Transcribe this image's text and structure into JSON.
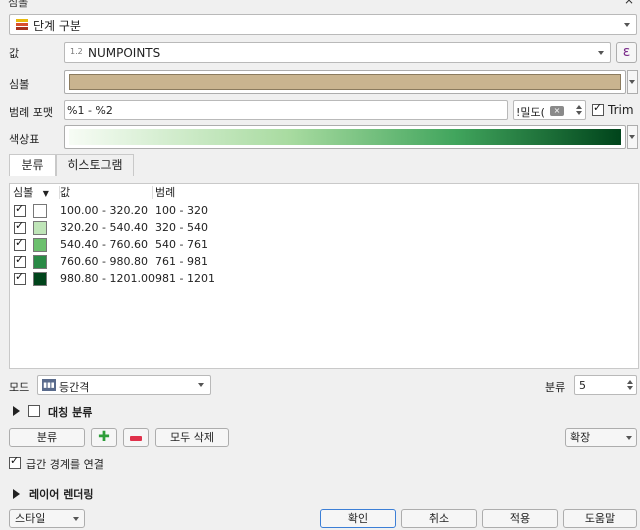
{
  "window": {
    "title": "심볼",
    "close_glyph": "×"
  },
  "renderer": {
    "selected": "단계 구분",
    "icon": "graduated-renderer-icon",
    "icon_colors": [
      "#e8b90d",
      "#d94f2b",
      "#a8321b"
    ]
  },
  "value_row": {
    "label": "값",
    "type_prefix": "1.2",
    "field": "NUMPOINTS",
    "expression_glyph": "ε"
  },
  "symbol_row": {
    "label": "심볼",
    "color": "#c9b48f"
  },
  "legend_format": {
    "label": "범례 포맷",
    "value": "%1 - %2",
    "precision_value": "!밀도(",
    "trim_label": "Trim",
    "trim_checked": true
  },
  "color_ramp": {
    "label": "색상표",
    "from": "#f7fcf5",
    "to": "#00441b"
  },
  "tabs": [
    {
      "label": "분류",
      "active": true
    },
    {
      "label": "히스토그램",
      "active": false
    }
  ],
  "table": {
    "headers": {
      "symbol": "심볼",
      "value": "값",
      "legend": "범례"
    },
    "rows": [
      {
        "checked": true,
        "color": "#ffffff",
        "value": "100.00 - 320.20",
        "legend": "100 - 320"
      },
      {
        "checked": true,
        "color": "#bfe5b8",
        "value": "320.20 - 540.40",
        "legend": "320 - 540"
      },
      {
        "checked": true,
        "color": "#6cc06e",
        "value": "540.40 - 760.60",
        "legend": "540 - 761"
      },
      {
        "checked": true,
        "color": "#2a8a46",
        "value": "760.60 - 980.80",
        "legend": "761 - 981"
      },
      {
        "checked": true,
        "color": "#00441b",
        "value": "980.80 - 1201.00",
        "legend": "981 - 1201"
      }
    ]
  },
  "mode": {
    "label": "모드",
    "selected": "등간격",
    "icon": "equal-interval-icon",
    "classes_label": "분류",
    "classes_value": "5"
  },
  "symmetric": {
    "label": "대칭 분류",
    "checked": false
  },
  "actions": {
    "classify": "분류",
    "add_icon": "plus-icon",
    "remove_icon": "minus-icon",
    "delete_all": "모두 삭제",
    "advanced": "확장"
  },
  "link_boundaries": {
    "label": "급간 경계를 연결",
    "checked": true
  },
  "layer_rendering": {
    "label": "레이어 렌더링"
  },
  "footer": {
    "style": "스타일",
    "ok": "확인",
    "cancel": "취소",
    "apply": "적용",
    "help": "도움말"
  }
}
